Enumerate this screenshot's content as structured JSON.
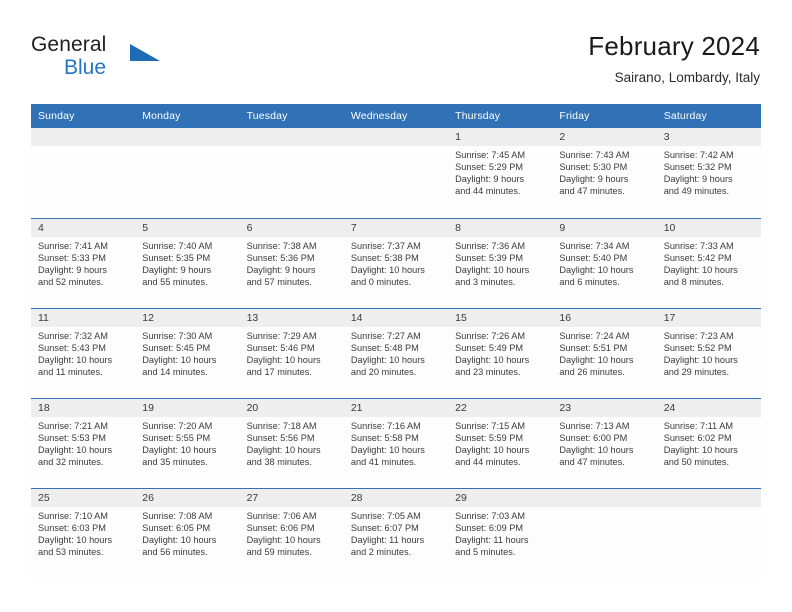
{
  "brand": {
    "name_top": "General",
    "name_bottom": "Blue"
  },
  "header": {
    "title": "February 2024",
    "location": "Sairano, Lombardy, Italy"
  },
  "weekday_headers": [
    "Sunday",
    "Monday",
    "Tuesday",
    "Wednesday",
    "Thursday",
    "Friday",
    "Saturday"
  ],
  "colors": {
    "header_blue": "#3072b5",
    "brand_blue": "#2276c4",
    "daynum_band": "#eeeeee",
    "text": "#3b3b3b"
  },
  "labels": {
    "sunrise_prefix": "Sunrise:",
    "sunset_prefix": "Sunset:",
    "daylight_prefix": "Daylight:"
  },
  "weeks": [
    [
      {
        "day": "",
        "empty": true
      },
      {
        "day": "",
        "empty": true
      },
      {
        "day": "",
        "empty": true
      },
      {
        "day": "",
        "empty": true
      },
      {
        "day": "1",
        "sunrise": "Sunrise: 7:45 AM",
        "sunset": "Sunset: 5:29 PM",
        "daylight_1": "Daylight: 9 hours",
        "daylight_2": "and 44 minutes."
      },
      {
        "day": "2",
        "sunrise": "Sunrise: 7:43 AM",
        "sunset": "Sunset: 5:30 PM",
        "daylight_1": "Daylight: 9 hours",
        "daylight_2": "and 47 minutes."
      },
      {
        "day": "3",
        "sunrise": "Sunrise: 7:42 AM",
        "sunset": "Sunset: 5:32 PM",
        "daylight_1": "Daylight: 9 hours",
        "daylight_2": "and 49 minutes."
      }
    ],
    [
      {
        "day": "4",
        "sunrise": "Sunrise: 7:41 AM",
        "sunset": "Sunset: 5:33 PM",
        "daylight_1": "Daylight: 9 hours",
        "daylight_2": "and 52 minutes."
      },
      {
        "day": "5",
        "sunrise": "Sunrise: 7:40 AM",
        "sunset": "Sunset: 5:35 PM",
        "daylight_1": "Daylight: 9 hours",
        "daylight_2": "and 55 minutes."
      },
      {
        "day": "6",
        "sunrise": "Sunrise: 7:38 AM",
        "sunset": "Sunset: 5:36 PM",
        "daylight_1": "Daylight: 9 hours",
        "daylight_2": "and 57 minutes."
      },
      {
        "day": "7",
        "sunrise": "Sunrise: 7:37 AM",
        "sunset": "Sunset: 5:38 PM",
        "daylight_1": "Daylight: 10 hours",
        "daylight_2": "and 0 minutes."
      },
      {
        "day": "8",
        "sunrise": "Sunrise: 7:36 AM",
        "sunset": "Sunset: 5:39 PM",
        "daylight_1": "Daylight: 10 hours",
        "daylight_2": "and 3 minutes."
      },
      {
        "day": "9",
        "sunrise": "Sunrise: 7:34 AM",
        "sunset": "Sunset: 5:40 PM",
        "daylight_1": "Daylight: 10 hours",
        "daylight_2": "and 6 minutes."
      },
      {
        "day": "10",
        "sunrise": "Sunrise: 7:33 AM",
        "sunset": "Sunset: 5:42 PM",
        "daylight_1": "Daylight: 10 hours",
        "daylight_2": "and 8 minutes."
      }
    ],
    [
      {
        "day": "11",
        "sunrise": "Sunrise: 7:32 AM",
        "sunset": "Sunset: 5:43 PM",
        "daylight_1": "Daylight: 10 hours",
        "daylight_2": "and 11 minutes."
      },
      {
        "day": "12",
        "sunrise": "Sunrise: 7:30 AM",
        "sunset": "Sunset: 5:45 PM",
        "daylight_1": "Daylight: 10 hours",
        "daylight_2": "and 14 minutes."
      },
      {
        "day": "13",
        "sunrise": "Sunrise: 7:29 AM",
        "sunset": "Sunset: 5:46 PM",
        "daylight_1": "Daylight: 10 hours",
        "daylight_2": "and 17 minutes."
      },
      {
        "day": "14",
        "sunrise": "Sunrise: 7:27 AM",
        "sunset": "Sunset: 5:48 PM",
        "daylight_1": "Daylight: 10 hours",
        "daylight_2": "and 20 minutes."
      },
      {
        "day": "15",
        "sunrise": "Sunrise: 7:26 AM",
        "sunset": "Sunset: 5:49 PM",
        "daylight_1": "Daylight: 10 hours",
        "daylight_2": "and 23 minutes."
      },
      {
        "day": "16",
        "sunrise": "Sunrise: 7:24 AM",
        "sunset": "Sunset: 5:51 PM",
        "daylight_1": "Daylight: 10 hours",
        "daylight_2": "and 26 minutes."
      },
      {
        "day": "17",
        "sunrise": "Sunrise: 7:23 AM",
        "sunset": "Sunset: 5:52 PM",
        "daylight_1": "Daylight: 10 hours",
        "daylight_2": "and 29 minutes."
      }
    ],
    [
      {
        "day": "18",
        "sunrise": "Sunrise: 7:21 AM",
        "sunset": "Sunset: 5:53 PM",
        "daylight_1": "Daylight: 10 hours",
        "daylight_2": "and 32 minutes."
      },
      {
        "day": "19",
        "sunrise": "Sunrise: 7:20 AM",
        "sunset": "Sunset: 5:55 PM",
        "daylight_1": "Daylight: 10 hours",
        "daylight_2": "and 35 minutes."
      },
      {
        "day": "20",
        "sunrise": "Sunrise: 7:18 AM",
        "sunset": "Sunset: 5:56 PM",
        "daylight_1": "Daylight: 10 hours",
        "daylight_2": "and 38 minutes."
      },
      {
        "day": "21",
        "sunrise": "Sunrise: 7:16 AM",
        "sunset": "Sunset: 5:58 PM",
        "daylight_1": "Daylight: 10 hours",
        "daylight_2": "and 41 minutes."
      },
      {
        "day": "22",
        "sunrise": "Sunrise: 7:15 AM",
        "sunset": "Sunset: 5:59 PM",
        "daylight_1": "Daylight: 10 hours",
        "daylight_2": "and 44 minutes."
      },
      {
        "day": "23",
        "sunrise": "Sunrise: 7:13 AM",
        "sunset": "Sunset: 6:00 PM",
        "daylight_1": "Daylight: 10 hours",
        "daylight_2": "and 47 minutes."
      },
      {
        "day": "24",
        "sunrise": "Sunrise: 7:11 AM",
        "sunset": "Sunset: 6:02 PM",
        "daylight_1": "Daylight: 10 hours",
        "daylight_2": "and 50 minutes."
      }
    ],
    [
      {
        "day": "25",
        "sunrise": "Sunrise: 7:10 AM",
        "sunset": "Sunset: 6:03 PM",
        "daylight_1": "Daylight: 10 hours",
        "daylight_2": "and 53 minutes."
      },
      {
        "day": "26",
        "sunrise": "Sunrise: 7:08 AM",
        "sunset": "Sunset: 6:05 PM",
        "daylight_1": "Daylight: 10 hours",
        "daylight_2": "and 56 minutes."
      },
      {
        "day": "27",
        "sunrise": "Sunrise: 7:06 AM",
        "sunset": "Sunset: 6:06 PM",
        "daylight_1": "Daylight: 10 hours",
        "daylight_2": "and 59 minutes."
      },
      {
        "day": "28",
        "sunrise": "Sunrise: 7:05 AM",
        "sunset": "Sunset: 6:07 PM",
        "daylight_1": "Daylight: 11 hours",
        "daylight_2": "and 2 minutes."
      },
      {
        "day": "29",
        "sunrise": "Sunrise: 7:03 AM",
        "sunset": "Sunset: 6:09 PM",
        "daylight_1": "Daylight: 11 hours",
        "daylight_2": "and 5 minutes."
      },
      {
        "day": "",
        "empty": true
      },
      {
        "day": "",
        "empty": true
      }
    ]
  ]
}
